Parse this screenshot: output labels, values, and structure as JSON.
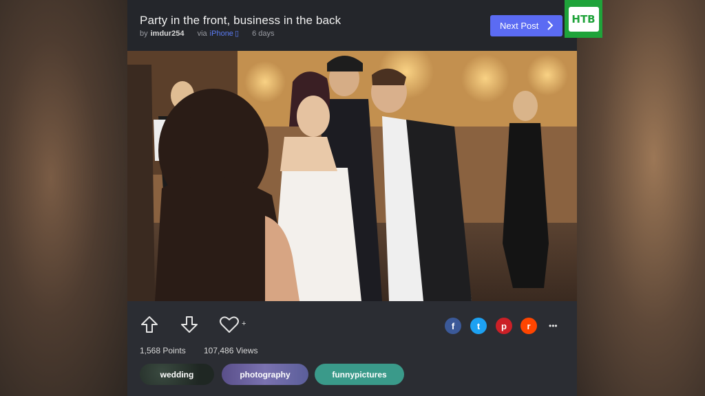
{
  "post": {
    "title": "Party in the front, business in the back",
    "by_prefix": "by",
    "author": "imdur254",
    "via_prefix": "via",
    "via_source": "iPhone",
    "age": "6 days",
    "next_label": "Next Post"
  },
  "stats": {
    "points": "1,568 Points",
    "views": "107,486 Views"
  },
  "favorite_plus": "+",
  "tags": [
    {
      "label": "wedding",
      "color": "#2a3a33"
    },
    {
      "label": "photography",
      "color": "#6a5f9a"
    },
    {
      "label": "funnypictures",
      "color": "#3a9a8a"
    }
  ],
  "share": [
    {
      "name": "facebook",
      "glyph": "f",
      "color": "#3b5998"
    },
    {
      "name": "twitter",
      "glyph": "t",
      "color": "#1da1f2"
    },
    {
      "name": "pinterest",
      "glyph": "p",
      "color": "#cb2027"
    },
    {
      "name": "reddit",
      "glyph": "r",
      "color": "#ff4500"
    }
  ],
  "more_label": "•••",
  "logo_text": "НТВ",
  "accent": "#5b6bf3"
}
